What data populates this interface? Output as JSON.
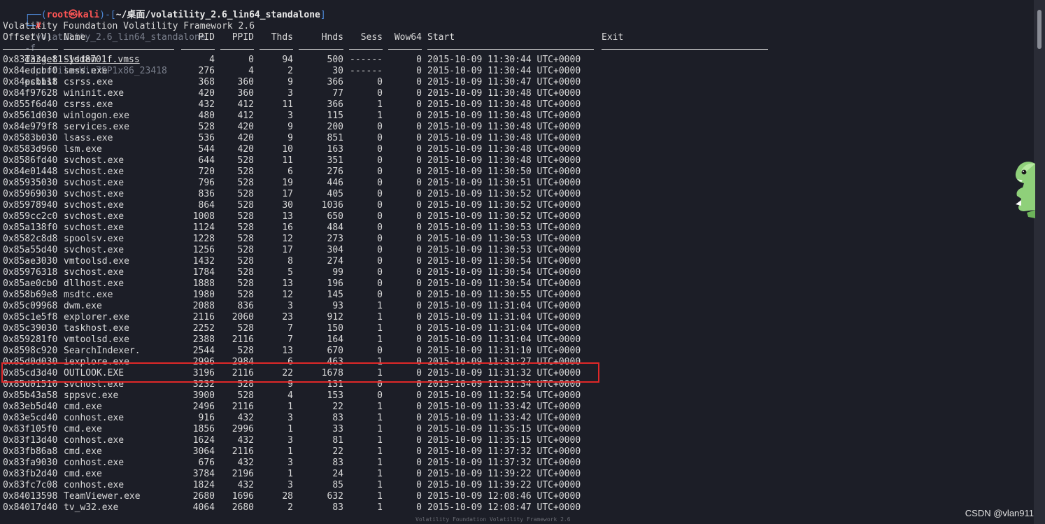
{
  "prompt": {
    "user": "root",
    "host": "kali",
    "path": "~/桌面/volatility_2.6_lin64_standalone",
    "symbol": "#",
    "command_exe": "./volatility_2.6_lin64_standalone",
    "flag_f": "-f",
    "target_file": "Target1-1dd8701f.vmss",
    "profile_arg": "--profile=Win7SP1x86_23418",
    "plugin": "pslist"
  },
  "banner": "Volatility Foundation Volatility Framework 2.6",
  "headers": {
    "offset": "Offset(V)",
    "name": "Name",
    "pid": "PID",
    "ppid": "PPID",
    "thds": "Thds",
    "hnds": "Hnds",
    "sess": "Sess",
    "wow64": "Wow64",
    "start": "Start",
    "exit": "Exit"
  },
  "rows": [
    {
      "offset": "0x83d334e8",
      "name": "System",
      "pid": "4",
      "ppid": "0",
      "thds": "94",
      "hnds": "500",
      "sess": "------",
      "wow64": "0",
      "start": "2015-10-09 11:30:44 UTC+0000"
    },
    {
      "offset": "0x84edcbf0",
      "name": "smss.exe",
      "pid": "276",
      "ppid": "4",
      "thds": "2",
      "hnds": "30",
      "sess": "------",
      "wow64": "0",
      "start": "2015-10-09 11:30:44 UTC+0000"
    },
    {
      "offset": "0x84ecbb18",
      "name": "csrss.exe",
      "pid": "368",
      "ppid": "360",
      "thds": "9",
      "hnds": "366",
      "sess": "0",
      "wow64": "0",
      "start": "2015-10-09 11:30:47 UTC+0000"
    },
    {
      "offset": "0x84f97628",
      "name": "wininit.exe",
      "pid": "420",
      "ppid": "360",
      "thds": "3",
      "hnds": "77",
      "sess": "0",
      "wow64": "0",
      "start": "2015-10-09 11:30:48 UTC+0000"
    },
    {
      "offset": "0x855f6d40",
      "name": "csrss.exe",
      "pid": "432",
      "ppid": "412",
      "thds": "11",
      "hnds": "366",
      "sess": "1",
      "wow64": "0",
      "start": "2015-10-09 11:30:48 UTC+0000"
    },
    {
      "offset": "0x8561d030",
      "name": "winlogon.exe",
      "pid": "480",
      "ppid": "412",
      "thds": "3",
      "hnds": "115",
      "sess": "1",
      "wow64": "0",
      "start": "2015-10-09 11:30:48 UTC+0000"
    },
    {
      "offset": "0x84e979f8",
      "name": "services.exe",
      "pid": "528",
      "ppid": "420",
      "thds": "9",
      "hnds": "200",
      "sess": "0",
      "wow64": "0",
      "start": "2015-10-09 11:30:48 UTC+0000"
    },
    {
      "offset": "0x8583b030",
      "name": "lsass.exe",
      "pid": "536",
      "ppid": "420",
      "thds": "9",
      "hnds": "851",
      "sess": "0",
      "wow64": "0",
      "start": "2015-10-09 11:30:48 UTC+0000"
    },
    {
      "offset": "0x8583d960",
      "name": "lsm.exe",
      "pid": "544",
      "ppid": "420",
      "thds": "10",
      "hnds": "163",
      "sess": "0",
      "wow64": "0",
      "start": "2015-10-09 11:30:48 UTC+0000"
    },
    {
      "offset": "0x8586fd40",
      "name": "svchost.exe",
      "pid": "644",
      "ppid": "528",
      "thds": "11",
      "hnds": "351",
      "sess": "0",
      "wow64": "0",
      "start": "2015-10-09 11:30:48 UTC+0000"
    },
    {
      "offset": "0x84e01448",
      "name": "svchost.exe",
      "pid": "720",
      "ppid": "528",
      "thds": "6",
      "hnds": "276",
      "sess": "0",
      "wow64": "0",
      "start": "2015-10-09 11:30:50 UTC+0000"
    },
    {
      "offset": "0x85935030",
      "name": "svchost.exe",
      "pid": "796",
      "ppid": "528",
      "thds": "19",
      "hnds": "446",
      "sess": "0",
      "wow64": "0",
      "start": "2015-10-09 11:30:51 UTC+0000"
    },
    {
      "offset": "0x85969030",
      "name": "svchost.exe",
      "pid": "836",
      "ppid": "528",
      "thds": "17",
      "hnds": "405",
      "sess": "0",
      "wow64": "0",
      "start": "2015-10-09 11:30:52 UTC+0000"
    },
    {
      "offset": "0x85978940",
      "name": "svchost.exe",
      "pid": "864",
      "ppid": "528",
      "thds": "30",
      "hnds": "1036",
      "sess": "0",
      "wow64": "0",
      "start": "2015-10-09 11:30:52 UTC+0000"
    },
    {
      "offset": "0x859cc2c0",
      "name": "svchost.exe",
      "pid": "1008",
      "ppid": "528",
      "thds": "13",
      "hnds": "650",
      "sess": "0",
      "wow64": "0",
      "start": "2015-10-09 11:30:52 UTC+0000"
    },
    {
      "offset": "0x85a138f0",
      "name": "svchost.exe",
      "pid": "1124",
      "ppid": "528",
      "thds": "16",
      "hnds": "484",
      "sess": "0",
      "wow64": "0",
      "start": "2015-10-09 11:30:53 UTC+0000"
    },
    {
      "offset": "0x8582c8d8",
      "name": "spoolsv.exe",
      "pid": "1228",
      "ppid": "528",
      "thds": "12",
      "hnds": "273",
      "sess": "0",
      "wow64": "0",
      "start": "2015-10-09 11:30:53 UTC+0000"
    },
    {
      "offset": "0x85a55d40",
      "name": "svchost.exe",
      "pid": "1256",
      "ppid": "528",
      "thds": "17",
      "hnds": "304",
      "sess": "0",
      "wow64": "0",
      "start": "2015-10-09 11:30:53 UTC+0000"
    },
    {
      "offset": "0x85ae3030",
      "name": "vmtoolsd.exe",
      "pid": "1432",
      "ppid": "528",
      "thds": "8",
      "hnds": "274",
      "sess": "0",
      "wow64": "0",
      "start": "2015-10-09 11:30:54 UTC+0000"
    },
    {
      "offset": "0x85976318",
      "name": "svchost.exe",
      "pid": "1784",
      "ppid": "528",
      "thds": "5",
      "hnds": "99",
      "sess": "0",
      "wow64": "0",
      "start": "2015-10-09 11:30:54 UTC+0000"
    },
    {
      "offset": "0x85ae0cb0",
      "name": "dllhost.exe",
      "pid": "1888",
      "ppid": "528",
      "thds": "13",
      "hnds": "196",
      "sess": "0",
      "wow64": "0",
      "start": "2015-10-09 11:30:54 UTC+0000"
    },
    {
      "offset": "0x858b69e8",
      "name": "msdtc.exe",
      "pid": "1980",
      "ppid": "528",
      "thds": "12",
      "hnds": "145",
      "sess": "0",
      "wow64": "0",
      "start": "2015-10-09 11:30:55 UTC+0000"
    },
    {
      "offset": "0x85c09968",
      "name": "dwm.exe",
      "pid": "2088",
      "ppid": "836",
      "thds": "3",
      "hnds": "93",
      "sess": "1",
      "wow64": "0",
      "start": "2015-10-09 11:31:04 UTC+0000"
    },
    {
      "offset": "0x85c1e5f8",
      "name": "explorer.exe",
      "pid": "2116",
      "ppid": "2060",
      "thds": "23",
      "hnds": "912",
      "sess": "1",
      "wow64": "0",
      "start": "2015-10-09 11:31:04 UTC+0000"
    },
    {
      "offset": "0x85c39030",
      "name": "taskhost.exe",
      "pid": "2252",
      "ppid": "528",
      "thds": "7",
      "hnds": "150",
      "sess": "1",
      "wow64": "0",
      "start": "2015-10-09 11:31:04 UTC+0000"
    },
    {
      "offset": "0x859281f0",
      "name": "vmtoolsd.exe",
      "pid": "2388",
      "ppid": "2116",
      "thds": "7",
      "hnds": "164",
      "sess": "1",
      "wow64": "0",
      "start": "2015-10-09 11:31:04 UTC+0000"
    },
    {
      "offset": "0x8598c920",
      "name": "SearchIndexer.",
      "pid": "2544",
      "ppid": "528",
      "thds": "13",
      "hnds": "670",
      "sess": "0",
      "wow64": "0",
      "start": "2015-10-09 11:31:10 UTC+0000"
    },
    {
      "offset": "0x85d0d030",
      "name": "iexplore.exe",
      "pid": "2996",
      "ppid": "2984",
      "thds": "6",
      "hnds": "463",
      "sess": "1",
      "wow64": "0",
      "start": "2015-10-09 11:31:27 UTC+0000"
    },
    {
      "offset": "0x85cd3d40",
      "name": "OUTLOOK.EXE",
      "pid": "3196",
      "ppid": "2116",
      "thds": "22",
      "hnds": "1678",
      "sess": "1",
      "wow64": "0",
      "start": "2015-10-09 11:31:32 UTC+0000"
    },
    {
      "offset": "0x85d01510",
      "name": "svchost.exe",
      "pid": "3232",
      "ppid": "528",
      "thds": "9",
      "hnds": "131",
      "sess": "0",
      "wow64": "0",
      "start": "2015-10-09 11:31:34 UTC+0000"
    },
    {
      "offset": "0x85b43a58",
      "name": "sppsvc.exe",
      "pid": "3900",
      "ppid": "528",
      "thds": "4",
      "hnds": "153",
      "sess": "0",
      "wow64": "0",
      "start": "2015-10-09 11:32:54 UTC+0000"
    },
    {
      "offset": "0x83eb5d40",
      "name": "cmd.exe",
      "pid": "2496",
      "ppid": "2116",
      "thds": "1",
      "hnds": "22",
      "sess": "1",
      "wow64": "0",
      "start": "2015-10-09 11:33:42 UTC+0000"
    },
    {
      "offset": "0x83e5cd40",
      "name": "conhost.exe",
      "pid": "916",
      "ppid": "432",
      "thds": "3",
      "hnds": "83",
      "sess": "1",
      "wow64": "0",
      "start": "2015-10-09 11:33:42 UTC+0000"
    },
    {
      "offset": "0x83f105f0",
      "name": "cmd.exe",
      "pid": "1856",
      "ppid": "2996",
      "thds": "1",
      "hnds": "33",
      "sess": "1",
      "wow64": "0",
      "start": "2015-10-09 11:35:15 UTC+0000"
    },
    {
      "offset": "0x83f13d40",
      "name": "conhost.exe",
      "pid": "1624",
      "ppid": "432",
      "thds": "3",
      "hnds": "81",
      "sess": "1",
      "wow64": "0",
      "start": "2015-10-09 11:35:15 UTC+0000"
    },
    {
      "offset": "0x83fb86a8",
      "name": "cmd.exe",
      "pid": "3064",
      "ppid": "2116",
      "thds": "1",
      "hnds": "22",
      "sess": "1",
      "wow64": "0",
      "start": "2015-10-09 11:37:32 UTC+0000"
    },
    {
      "offset": "0x83fa9030",
      "name": "conhost.exe",
      "pid": "676",
      "ppid": "432",
      "thds": "3",
      "hnds": "83",
      "sess": "1",
      "wow64": "0",
      "start": "2015-10-09 11:37:32 UTC+0000"
    },
    {
      "offset": "0x83fb2d40",
      "name": "cmd.exe",
      "pid": "3784",
      "ppid": "2196",
      "thds": "1",
      "hnds": "24",
      "sess": "1",
      "wow64": "0",
      "start": "2015-10-09 11:39:22 UTC+0000"
    },
    {
      "offset": "0x83fc7c08",
      "name": "conhost.exe",
      "pid": "1824",
      "ppid": "432",
      "thds": "3",
      "hnds": "85",
      "sess": "1",
      "wow64": "0",
      "start": "2015-10-09 11:39:22 UTC+0000"
    },
    {
      "offset": "0x84013598",
      "name": "TeamViewer.exe",
      "pid": "2680",
      "ppid": "1696",
      "thds": "28",
      "hnds": "632",
      "sess": "1",
      "wow64": "0",
      "start": "2015-10-09 12:08:46 UTC+0000"
    },
    {
      "offset": "0x84017d40",
      "name": "tv_w32.exe",
      "pid": "4064",
      "ppid": "2680",
      "thds": "2",
      "hnds": "83",
      "sess": "1",
      "wow64": "0",
      "start": "2015-10-09 12:08:47 UTC+0000"
    }
  ],
  "watermark": "CSDN @vlan911",
  "colors": {
    "background": "#1c1e27",
    "highlight": "#e02828",
    "prompt_red": "#ef4f4f",
    "prompt_blue": "#4e89d8"
  }
}
